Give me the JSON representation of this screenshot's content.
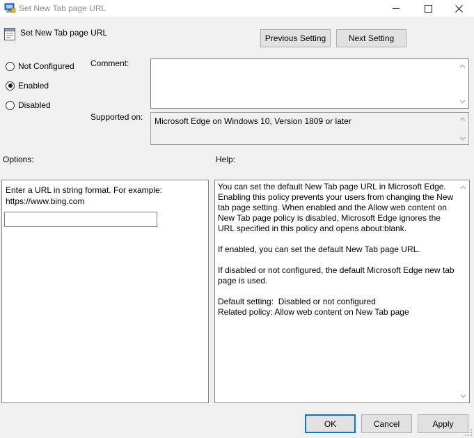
{
  "window": {
    "title": "Set New Tab page URL"
  },
  "header": {
    "policy_title": "Set New Tab page URL",
    "prev_label": "Previous Setting",
    "next_label": "Next Setting"
  },
  "state": {
    "options": [
      {
        "label": "Not Configured",
        "selected": false
      },
      {
        "label": "Enabled",
        "selected": true
      },
      {
        "label": "Disabled",
        "selected": false
      }
    ]
  },
  "comment": {
    "label": "Comment:",
    "value": ""
  },
  "supported": {
    "label": "Supported on:",
    "value": "Microsoft Edge on Windows 10, Version 1809 or later"
  },
  "options_panel": {
    "label": "Options:",
    "instruction": "Enter a URL in string format. For example: https://www.bing.com",
    "url_value": ""
  },
  "help_panel": {
    "label": "Help:",
    "paragraphs": [
      "You can set the default New Tab page URL in Microsoft Edge. Enabling this policy prevents your users from changing the New tab page setting. When enabled and the Allow web content on New Tab page policy is disabled, Microsoft Edge ignores the URL specified in this policy and opens about:blank.",
      "If enabled, you can set the default New Tab page URL.",
      "If disabled or not configured, the default Microsoft Edge new tab page is used."
    ],
    "default_setting": "Default setting:  Disabled or not configured",
    "related_policy": "Related policy: Allow web content on New Tab page"
  },
  "footer": {
    "ok_label": "OK",
    "cancel_label": "Cancel",
    "apply_label": "Apply"
  },
  "colors": {
    "accent": "#0078d7",
    "background": "#f0f0f0"
  }
}
